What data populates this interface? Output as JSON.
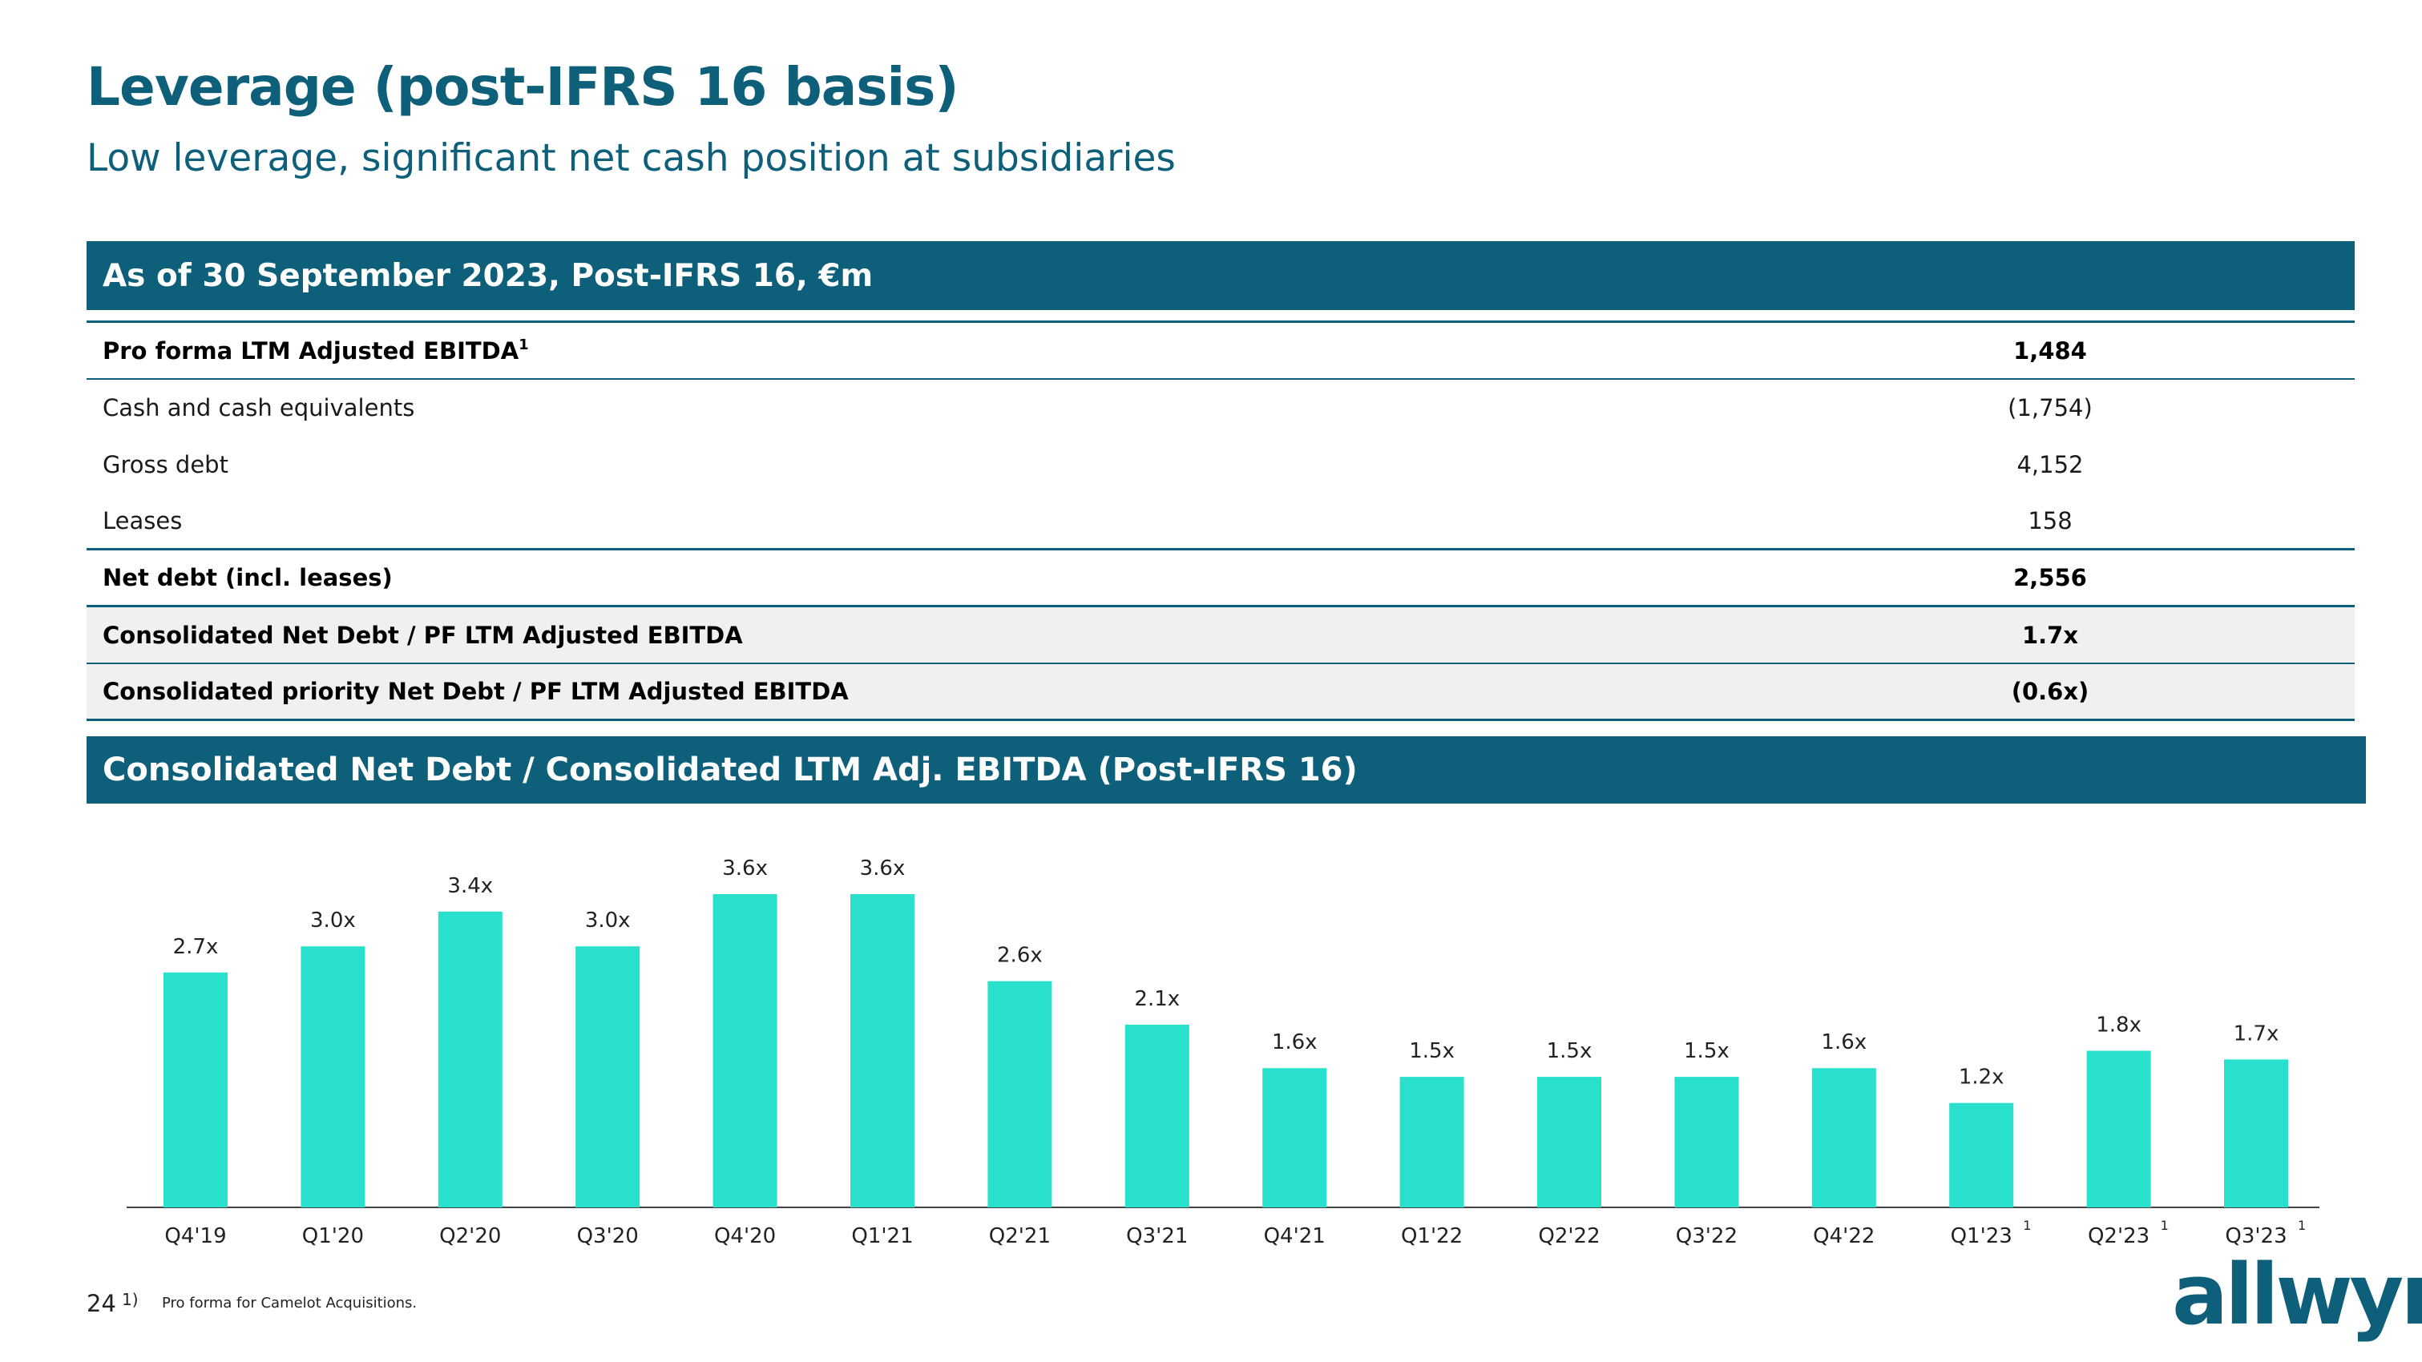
{
  "header": {
    "title": "Leverage (post-IFRS 16 basis)",
    "subtitle": "Low leverage, significant net cash position at subsidiaries"
  },
  "table": {
    "heading": "As of 30 September 2023, Post-IFRS 16, €m",
    "rows": [
      {
        "label": "Pro forma LTM Adjusted EBITDA",
        "footnote": "1",
        "value": "1,484"
      },
      {
        "label": "Cash and cash equivalents",
        "value": "(1,754)"
      },
      {
        "label": "Gross debt",
        "value": "4,152"
      },
      {
        "label": "Leases",
        "value": "158"
      },
      {
        "label": "Net debt (incl. leases)",
        "value": "2,556"
      },
      {
        "label": "Consolidated Net Debt / PF LTM Adjusted EBITDA",
        "value": "1.7x"
      },
      {
        "label": "Consolidated priority Net Debt / PF LTM Adjusted EBITDA",
        "value": "(0.6x)"
      }
    ]
  },
  "chart_heading": "Consolidated Net Debt / Consolidated LTM Adj. EBITDA (Post-IFRS 16)",
  "chart_data": {
    "type": "bar",
    "categories": [
      "Q4'19",
      "Q1'20",
      "Q2'20",
      "Q3'20",
      "Q4'20",
      "Q1'21",
      "Q2'21",
      "Q3'21",
      "Q4'21",
      "Q1'22",
      "Q2'22",
      "Q3'22",
      "Q4'22",
      "Q1'23",
      "Q2'23",
      "Q3'23"
    ],
    "category_footnotes": [
      "",
      "",
      "",
      "",
      "",
      "",
      "",
      "",
      "",
      "",
      "",
      "",
      "",
      "1",
      "1",
      "1"
    ],
    "values": [
      2.7,
      3.0,
      3.4,
      3.0,
      3.6,
      3.6,
      2.6,
      2.1,
      1.6,
      1.5,
      1.5,
      1.5,
      1.6,
      1.2,
      1.8,
      1.7
    ],
    "data_labels": [
      "2.7x",
      "3.0x",
      "3.4x",
      "3.0x",
      "3.6x",
      "3.6x",
      "2.6x",
      "2.1x",
      "1.6x",
      "1.5x",
      "1.5x",
      "1.5x",
      "1.6x",
      "1.2x",
      "1.8x",
      "1.7x"
    ],
    "title": "Consolidated Net Debt / Consolidated LTM Adj. EBITDA (Post-IFRS 16)",
    "xlabel": "",
    "ylabel": "",
    "ylim": [
      0,
      3.6
    ],
    "grid": false,
    "bar_color": "#29e0cd"
  },
  "footer": {
    "page_number": "24",
    "footnote_marker": "1)",
    "footnote_text": "Pro forma for Camelot Acquisitions."
  },
  "logo_text": "allwyn",
  "colors": {
    "brand": "#0e5f79",
    "bar": "#29e0cd",
    "row_shade": "#f0f0f0"
  }
}
